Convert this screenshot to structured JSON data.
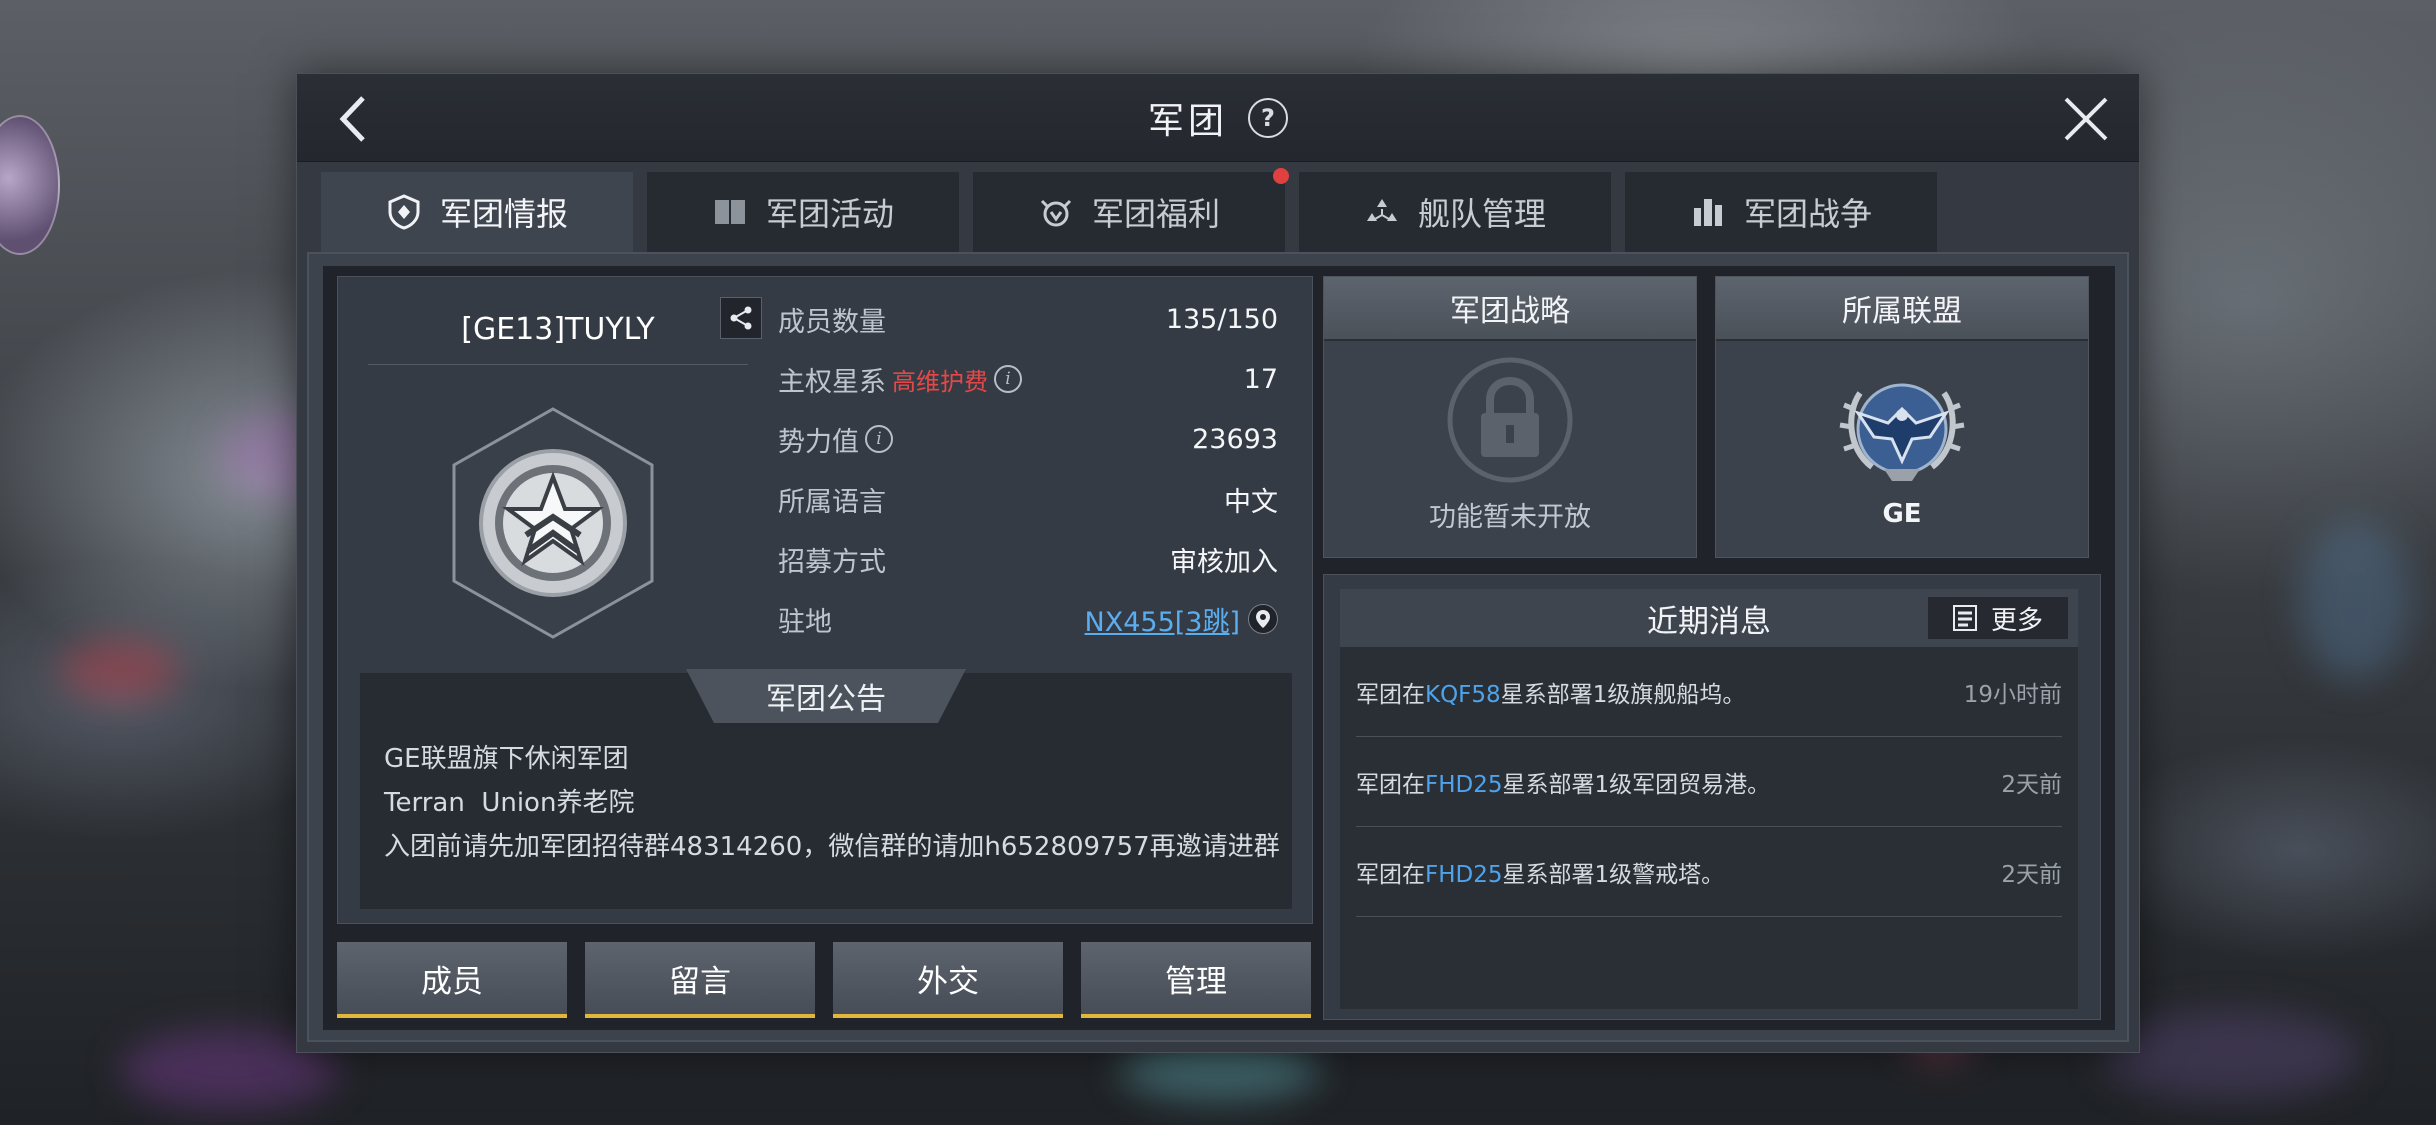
{
  "window": {
    "title": "军团",
    "help_icon": "question-mark-icon",
    "back_icon": "chevron-left-icon",
    "close_icon": "close-icon"
  },
  "tabs": [
    {
      "label": "军团情报",
      "icon": "shield-icon",
      "active": true,
      "badge": false
    },
    {
      "label": "军团活动",
      "icon": "book-icon",
      "active": false,
      "badge": false
    },
    {
      "label": "军团福利",
      "icon": "gift-icon",
      "active": false,
      "badge": true
    },
    {
      "label": "舰队管理",
      "icon": "fleet-icon",
      "active": false,
      "badge": false
    },
    {
      "label": "军团战争",
      "icon": "buildings-icon",
      "active": false,
      "badge": false
    }
  ],
  "guild": {
    "name": "[GE13]TUYLY",
    "emblem_icon": "star-chevron-emblem-icon",
    "stats": {
      "members_label": "成员数量",
      "members_value": "135/150",
      "capital_label": "主权星系",
      "capital_warning": "高维护费",
      "capital_value": "17",
      "power_label": "势力值",
      "power_value": "23693",
      "language_label": "所属语言",
      "language_value": "中文",
      "recruit_label": "招募方式",
      "recruit_value": "审核加入",
      "base_label": "驻地",
      "base_value": "NX455[3跳]"
    }
  },
  "notice": {
    "title": "军团公告",
    "lines": [
      "GE联盟旗下休闲军团",
      "Terran  Union养老院",
      "入团前请先加军团招待群48314260，微信群的请加h652809757再邀请进群"
    ]
  },
  "buttons": {
    "members": "成员",
    "message": "留言",
    "diplomacy": "外交",
    "manage": "管理"
  },
  "strategy": {
    "title": "军团战略",
    "note": "功能暂未开放",
    "icon": "lock-icon"
  },
  "alliance": {
    "title": "所属联盟",
    "name": "GE",
    "icon": "eagle-emblem-icon"
  },
  "news": {
    "title": "近期消息",
    "more": "更多",
    "items": [
      {
        "prefix": "军团在",
        "system": "KQF58",
        "suffix": "星系部署1级旗舰船坞。",
        "time": "19小时前"
      },
      {
        "prefix": "军团在",
        "system": "FHD25",
        "suffix": "星系部署1级军团贸易港。",
        "time": "2天前"
      },
      {
        "prefix": "军团在",
        "system": "FHD25",
        "suffix": "星系部署1级警戒塔。",
        "time": "2天前"
      }
    ]
  },
  "colors": {
    "accent_underline": "#e2b53c",
    "warning": "#e64848",
    "link": "#5aaef0",
    "badge": "#e04040"
  }
}
